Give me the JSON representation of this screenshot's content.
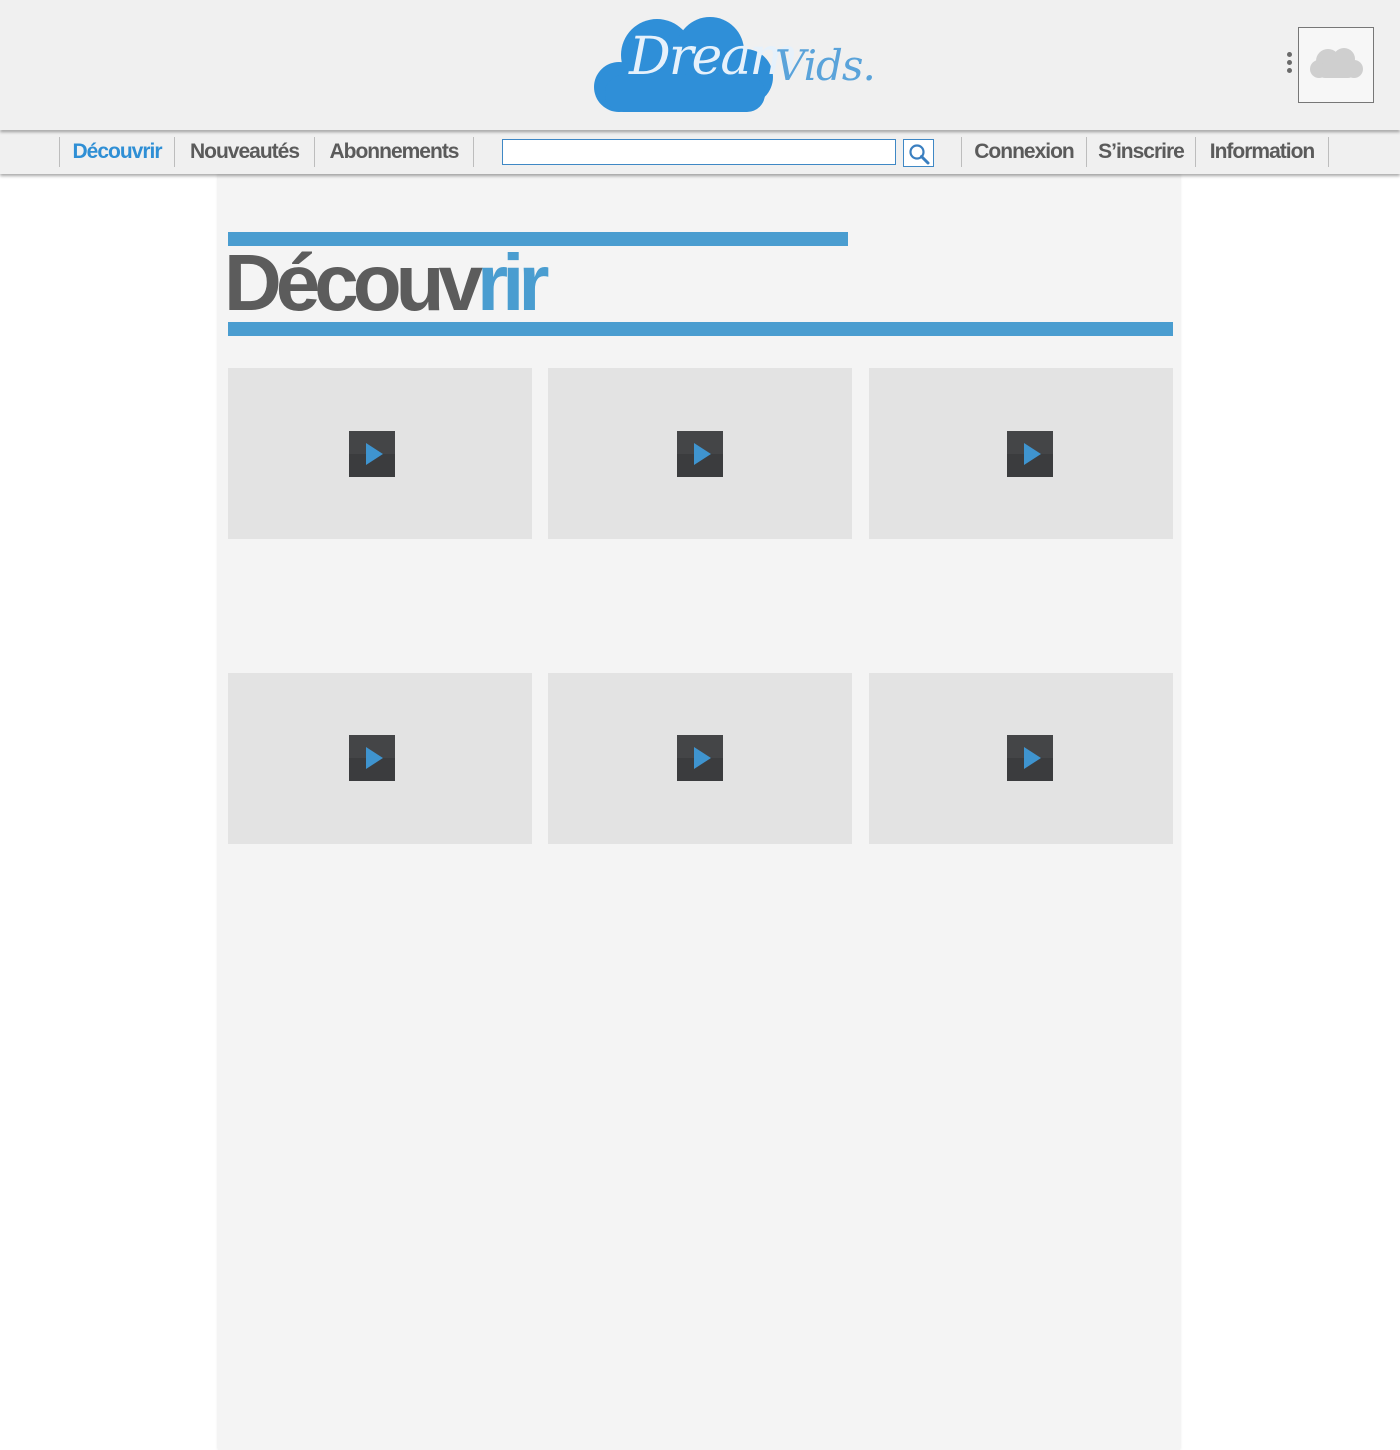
{
  "header": {
    "logo_word1": "Dream",
    "logo_word2": "Vids."
  },
  "nav": {
    "left_items": [
      {
        "label": "Découvrir",
        "active": true
      },
      {
        "label": "Nouveautés",
        "active": false
      },
      {
        "label": "Abonnements",
        "active": false
      }
    ],
    "search": {
      "value": "",
      "placeholder": ""
    },
    "right_items": [
      {
        "label": "Connexion"
      },
      {
        "label": "S’inscrire"
      },
      {
        "label": "Information"
      }
    ]
  },
  "main": {
    "title_part1": "Découv",
    "title_part2": "rir",
    "videos": [
      {
        "icon": "play-icon"
      },
      {
        "icon": "play-icon"
      },
      {
        "icon": "play-icon"
      },
      {
        "icon": "play-icon"
      },
      {
        "icon": "play-icon"
      },
      {
        "icon": "play-icon"
      }
    ]
  },
  "colors": {
    "accent": "#2f8fd5",
    "title_accent": "#4a9dd0",
    "text": "#5b5b5b",
    "header_bg": "#f0f0f0",
    "panel_bg": "#f4f4f4",
    "tile_bg": "#e3e3e3",
    "play_bg": "#3b3c3e"
  }
}
